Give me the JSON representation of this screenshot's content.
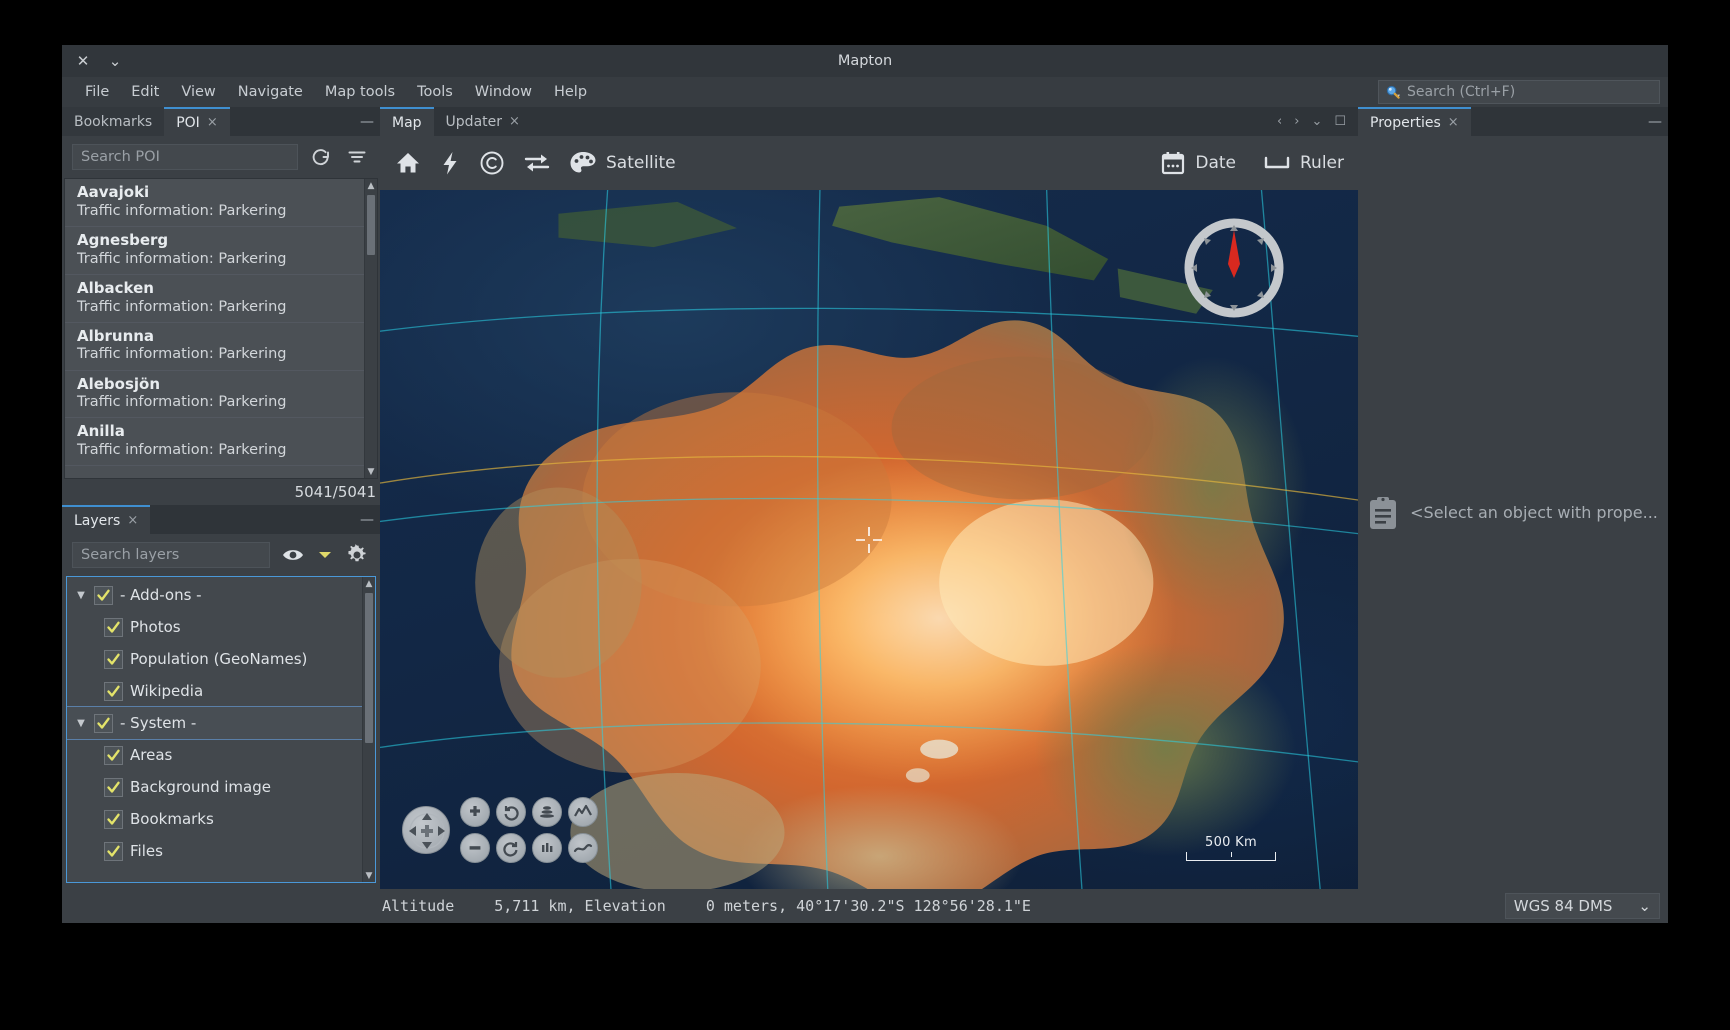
{
  "window": {
    "title": "Mapton",
    "close_label": "✕",
    "menu_label": "⌄"
  },
  "menubar": {
    "items": [
      "File",
      "Edit",
      "View",
      "Navigate",
      "Map tools",
      "Tools",
      "Window",
      "Help"
    ],
    "search": {
      "placeholder": "Search (Ctrl+F)",
      "icon": "search-icon"
    }
  },
  "left_panel": {
    "tabs": [
      {
        "label": "Bookmarks",
        "active": false,
        "closable": false
      },
      {
        "label": "POI",
        "active": true,
        "closable": true,
        "close_label": "×"
      }
    ],
    "minimize_label": "—",
    "search": {
      "placeholder": "Search POI"
    },
    "refresh_icon": "refresh-icon",
    "filter_icon": "filter-icon",
    "poi_items": [
      {
        "name": "Aavajoki",
        "desc": "Traffic information: Parkering"
      },
      {
        "name": "Agnesberg",
        "desc": "Traffic information: Parkering"
      },
      {
        "name": "Albacken",
        "desc": "Traffic information: Parkering"
      },
      {
        "name": "Albrunna",
        "desc": "Traffic information: Parkering"
      },
      {
        "name": "Alebosjön",
        "desc": "Traffic information: Parkering"
      },
      {
        "name": "Anilla",
        "desc": "Traffic information: Parkering"
      }
    ],
    "count": "5041/5041"
  },
  "layers_panel": {
    "tab": {
      "label": "Layers",
      "close_label": "×"
    },
    "minimize_label": "—",
    "search": {
      "placeholder": "Search layers"
    },
    "eye_icon": "eye-icon",
    "dropdown_icon": "chevron-down-icon",
    "settings_icon": "gear-icon",
    "tree": [
      {
        "label": "- Add-ons -",
        "level": 0,
        "checked": true,
        "expanded": true,
        "selected": false
      },
      {
        "label": "Photos",
        "level": 1,
        "checked": true,
        "expanded": null,
        "selected": false
      },
      {
        "label": "Population (GeoNames)",
        "level": 1,
        "checked": true,
        "expanded": null,
        "selected": false
      },
      {
        "label": "Wikipedia",
        "level": 1,
        "checked": true,
        "expanded": null,
        "selected": false
      },
      {
        "label": "- System -",
        "level": 0,
        "checked": true,
        "expanded": true,
        "selected": true
      },
      {
        "label": "Areas",
        "level": 1,
        "checked": true,
        "expanded": null,
        "selected": false
      },
      {
        "label": "Background image",
        "level": 1,
        "checked": true,
        "expanded": null,
        "selected": false
      },
      {
        "label": "Bookmarks",
        "level": 1,
        "checked": true,
        "expanded": null,
        "selected": false
      },
      {
        "label": "Files",
        "level": 1,
        "checked": true,
        "expanded": null,
        "selected": false
      }
    ]
  },
  "map_panel": {
    "tabs": [
      {
        "label": "Map",
        "active": true,
        "closable": false
      },
      {
        "label": "Updater",
        "active": false,
        "closable": true,
        "close_label": "×"
      }
    ],
    "controls": [
      "‹",
      "›",
      "⌄",
      "☐"
    ],
    "toolbar": {
      "home_icon": "home-icon",
      "bolt_icon": "lightning-icon",
      "copyright_icon": "copyright-icon",
      "swap_icon": "swap-arrows-icon",
      "palette_icon": "palette-icon",
      "satellite_label": "Satellite",
      "date_icon": "calendar-icon",
      "date_label": "Date",
      "ruler_icon": "ruler-icon",
      "ruler_label": "Ruler"
    },
    "scale_label": "500 Km",
    "compass_icon": "compass-icon",
    "nav": {
      "pan_icon": "pan-pad-icon",
      "buttons": [
        "zoom-in-icon",
        "rotate-ccw-icon",
        "tilt-icon",
        "terrain-icon",
        "zoom-out-icon",
        "rotate-cw-icon",
        "elevation-icon",
        "horizon-icon"
      ]
    }
  },
  "properties_panel": {
    "tab": {
      "label": "Properties",
      "close_label": "×"
    },
    "minimize_label": "—",
    "icon": "clipboard-icon",
    "placeholder": "<Select an object with prope..."
  },
  "statusbar": {
    "altitude_label": "Altitude",
    "altitude_value": "5,711 km, Elevation",
    "position_value": "0 meters, 40°17'30.2\"S 128°56'28.1\"E",
    "coord_system": "WGS 84 DMS",
    "coord_chevron": "⌄"
  },
  "colors": {
    "accent": "#3f8fd0",
    "panel_bg": "#3b4045",
    "tab_bg": "#2f3439",
    "check": "#e3e36a",
    "tree_border": "#4a98d8",
    "compass_needle": "#d9291f"
  }
}
